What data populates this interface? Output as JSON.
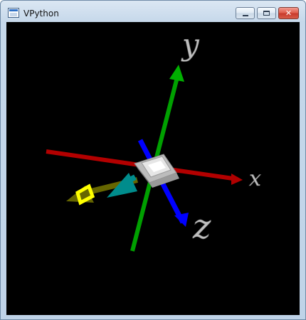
{
  "window": {
    "title": "VPython",
    "buttons": {
      "minimize": "–",
      "maximize": "□",
      "close": "✕"
    }
  },
  "scene": {
    "axis_labels": {
      "x": "x",
      "y": "y",
      "z": "z"
    },
    "colors": {
      "background": "#000000",
      "x_axis": "#b30000",
      "y_axis": "#00a000",
      "z_axis": "#0000ff",
      "box": "#d9d9d9",
      "yellow_ring": "#ffff00",
      "olive_arrow": "#666600",
      "teal_arrow": "#008c8c",
      "label": "#c0c0c0"
    }
  }
}
